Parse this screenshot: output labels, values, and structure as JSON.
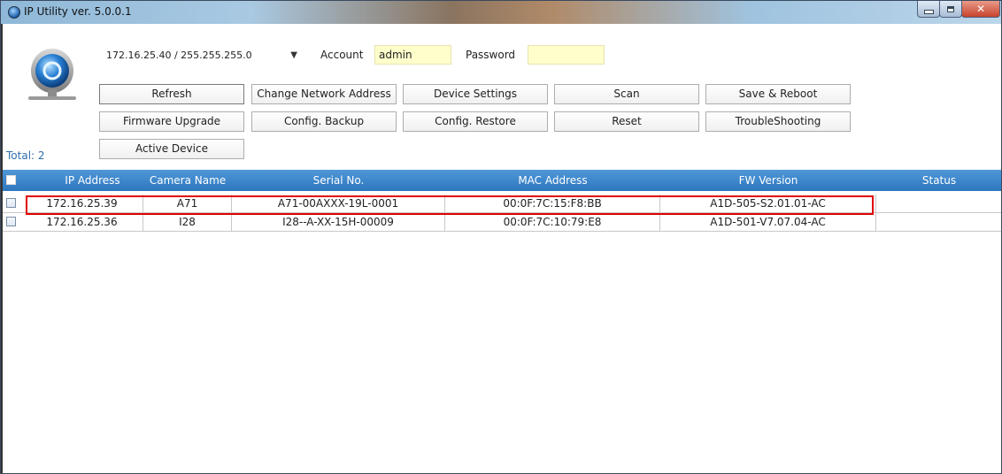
{
  "window": {
    "title": "IP Utility ver. 5.0.0.1"
  },
  "toolbar": {
    "network_select": "172.16.25.40 / 255.255.255.0",
    "account_label": "Account",
    "account_value": "admin",
    "password_label": "Password",
    "password_value": "",
    "total": "Total: 2",
    "buttons": {
      "refresh": "Refresh",
      "change_network": "Change Network Address",
      "device_settings": "Device Settings",
      "scan": "Scan",
      "save_reboot": "Save & Reboot",
      "firmware_upgrade": "Firmware Upgrade",
      "config_backup": "Config. Backup",
      "config_restore": "Config. Restore",
      "reset": "Reset",
      "troubleshooting": "TroubleShooting",
      "active_device": "Active Device"
    }
  },
  "table": {
    "columns": [
      "IP Address",
      "Camera Name",
      "Serial No.",
      "MAC Address",
      "FW Version",
      "Status"
    ],
    "rows": [
      {
        "ip": "172.16.25.39",
        "name": "A71",
        "serial": "A71-00AXXX-19L-0001",
        "mac": "00:0F:7C:15:F8:BB",
        "fw": "A1D-505-S2.01.01-AC",
        "status": "",
        "checked": false,
        "highlighted": true
      },
      {
        "ip": "172.16.25.36",
        "name": "I28",
        "serial": "I28--A-XX-15H-00009",
        "mac": "00:0F:7C:10:79:E8",
        "fw": "A1D-501-V7.07.04-AC",
        "status": "",
        "checked": false,
        "highlighted": false
      }
    ]
  },
  "colors": {
    "header_blue": "#2e77c0",
    "highlight_red": "#e00000",
    "input_yellow": "#ffffcc",
    "total_blue": "#2f6fb0"
  }
}
